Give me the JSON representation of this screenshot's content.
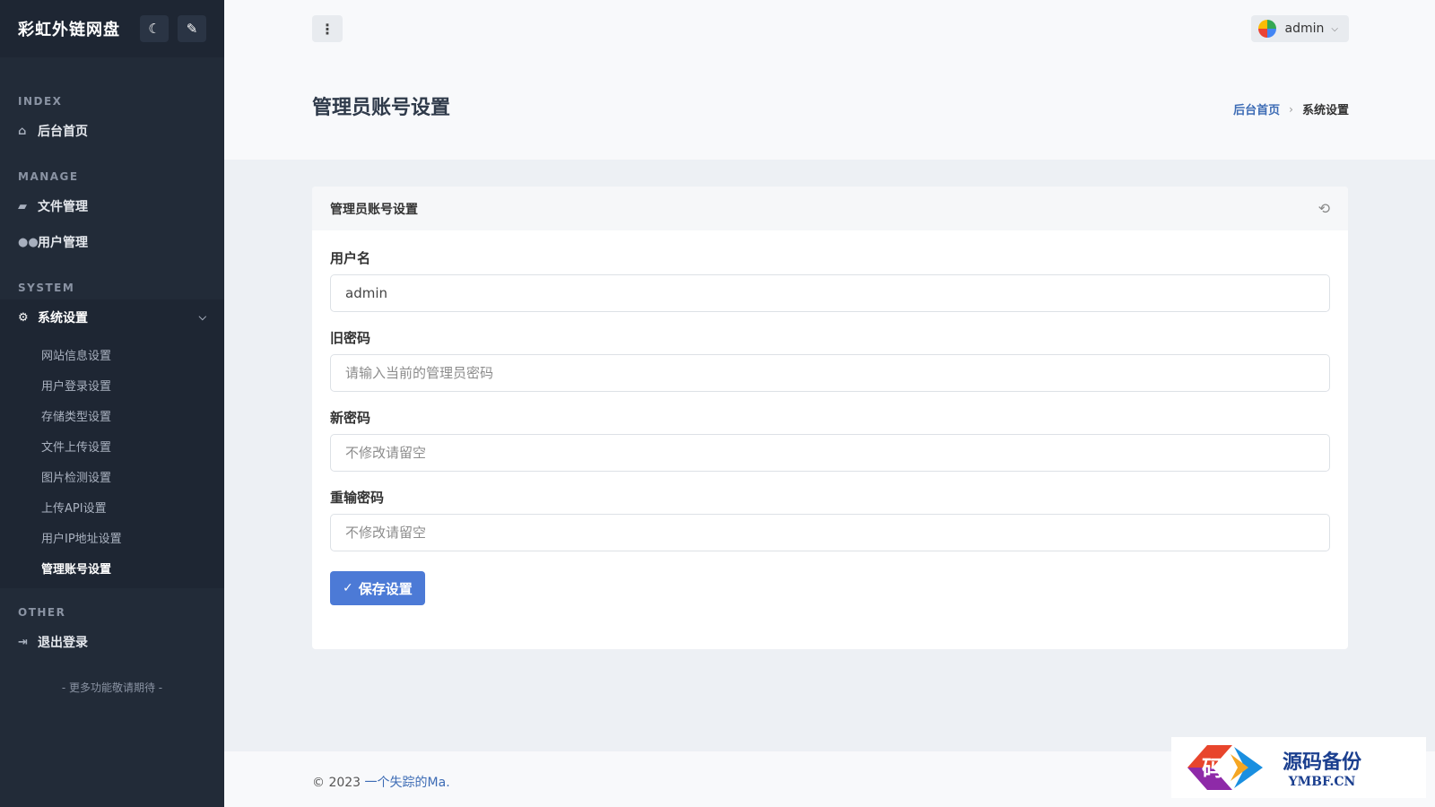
{
  "sidebar": {
    "brand": "彩虹外链网盘",
    "sections": {
      "index": "INDEX",
      "manage": "MANAGE",
      "system": "SYSTEM",
      "other": "OTHER"
    },
    "items": {
      "home": "后台首页",
      "files": "文件管理",
      "users": "用户管理",
      "settings": "系统设置",
      "logout": "退出登录"
    },
    "sub_items": [
      "网站信息设置",
      "用户登录设置",
      "存储类型设置",
      "文件上传设置",
      "图片检测设置",
      "上传API设置",
      "用户IP地址设置",
      "管理账号设置"
    ],
    "tagline": "- 更多功能敬请期待 -"
  },
  "header": {
    "menu_glyph": "⋮",
    "username": "admin"
  },
  "page": {
    "title": "管理员账号设置",
    "breadcrumb": {
      "home": "后台首页",
      "current": "系统设置"
    }
  },
  "card": {
    "title": "管理员账号设置",
    "fields": {
      "username": {
        "label": "用户名",
        "value": "admin"
      },
      "old_password": {
        "label": "旧密码",
        "placeholder": "请输入当前的管理员密码"
      },
      "new_password": {
        "label": "新密码",
        "placeholder": "不修改请留空"
      },
      "confirm_password": {
        "label": "重输密码",
        "placeholder": "不修改请留空"
      }
    },
    "save_label": "保存设置"
  },
  "footer": {
    "copyright": "© 2023 ",
    "author": "一个失踪的Ma."
  },
  "watermark": {
    "cn": "源码备份",
    "en": "YMBF.CN",
    "logo_char": "码"
  },
  "colors": {
    "sidebar_bg": "#222b38",
    "primary": "#4c7ad6",
    "link": "#3d6cb5"
  }
}
